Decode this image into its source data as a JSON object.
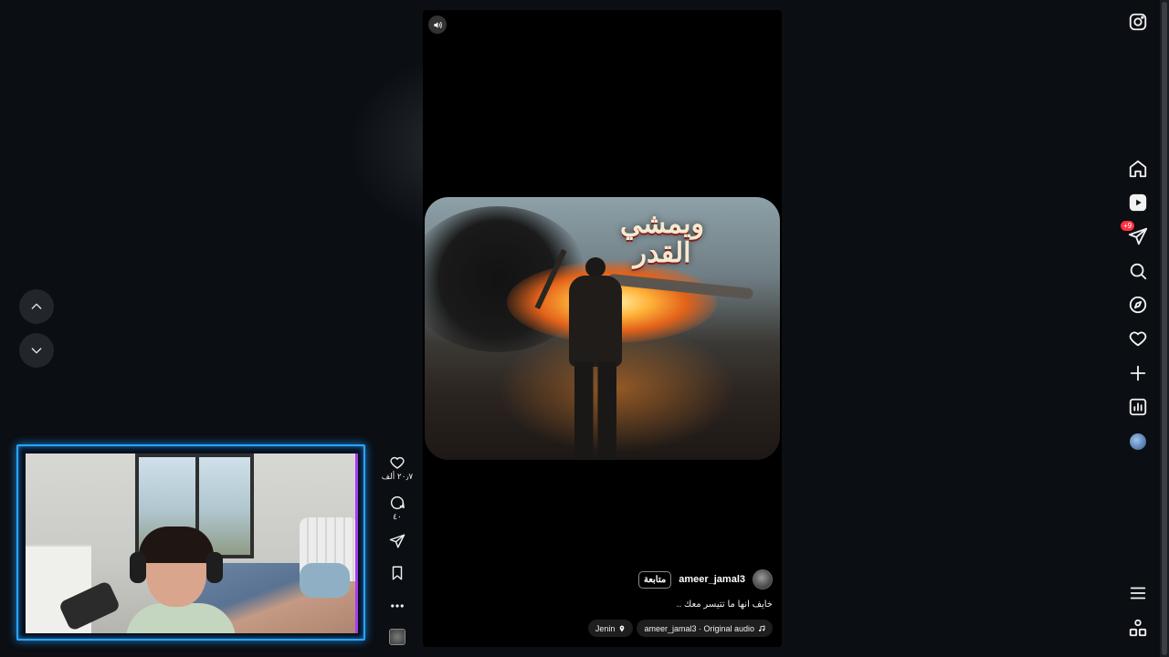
{
  "nav": {
    "items": [
      {
        "name": "instagram-logo",
        "icon": "instagram-icon"
      },
      {
        "name": "home",
        "icon": "home-icon"
      },
      {
        "name": "reels",
        "icon": "reels-icon"
      },
      {
        "name": "messages",
        "icon": "send-icon",
        "badge": "+9"
      },
      {
        "name": "search",
        "icon": "search-icon"
      },
      {
        "name": "explore",
        "icon": "compass-icon"
      },
      {
        "name": "notifications",
        "icon": "heart-icon"
      },
      {
        "name": "create",
        "icon": "plus-icon"
      },
      {
        "name": "dashboard",
        "icon": "chart-icon"
      },
      {
        "name": "profile",
        "icon": "avatar-icon"
      },
      {
        "name": "more",
        "icon": "menu-icon"
      },
      {
        "name": "also-from-meta",
        "icon": "apps-icon"
      }
    ],
    "messages_badge": "+9"
  },
  "reel": {
    "title_art_line1": "ويمشي",
    "title_art_line2": "القدر",
    "author": "ameer_jamal3",
    "follow_label": "متابعة",
    "caption": "خايف انها ما تتيسر معك ..",
    "audio": "ameer_jamal3 · Original audio",
    "location": "Jenin"
  },
  "actions": {
    "likes": "٢٠٫٧ ألف",
    "comments": "٤٠"
  },
  "colors": {
    "background": "#0b0e12",
    "webcam_border": "#2aa3ff",
    "badge": "#ff3040"
  }
}
